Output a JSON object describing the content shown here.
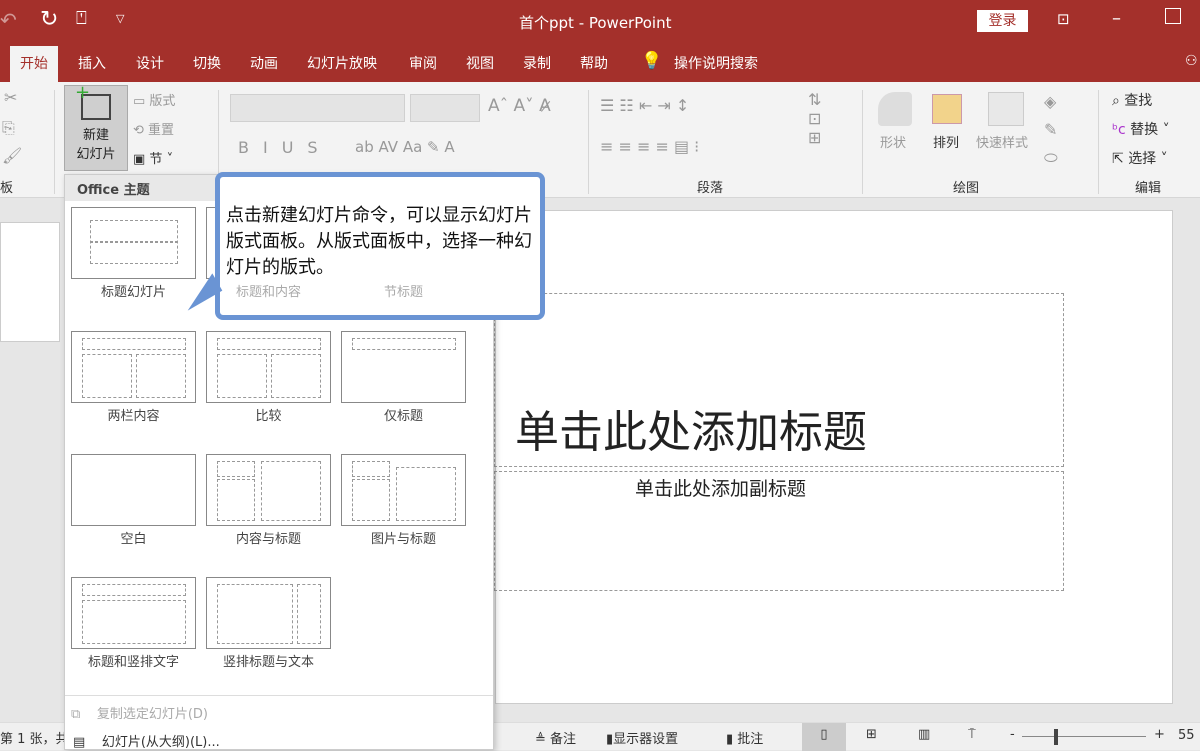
{
  "window": {
    "title": "首个ppt  -  PowerPoint",
    "login": "登录"
  },
  "tabs": [
    "开始",
    "插入",
    "设计",
    "切换",
    "动画",
    "幻灯片放映",
    "审阅",
    "视图",
    "录制",
    "帮助"
  ],
  "tell_me": "操作说明搜索",
  "ribbon": {
    "slides": {
      "new_slide_line1": "新建",
      "new_slide_line2": "幻灯片",
      "layout": "版式",
      "reset": "重置",
      "section": "节"
    },
    "clipboard_label": "板",
    "paragraph_label": "段落",
    "drawing": {
      "shape": "形状",
      "arrange": "排列",
      "quick_styles": "快速样式",
      "label": "绘图"
    },
    "editing": {
      "find": "查找",
      "replace": "替换",
      "select": "选择",
      "label": "编辑"
    }
  },
  "gallery": {
    "header": "Office 主题",
    "layouts": [
      "标题幻灯片",
      "标题和内容",
      "节标题",
      "两栏内容",
      "比较",
      "仅标题",
      "空白",
      "内容与标题",
      "图片与标题",
      "标题和竖排文字",
      "竖排标题与文本"
    ],
    "duplicate": "复制选定幻灯片(D)",
    "from_outline": "幻灯片(从大纲)(L)..."
  },
  "callout": "点击新建幻灯片命令，可以显示幻灯片版式面板。从版式面板中，选择一种幻灯片的版式。",
  "slide": {
    "title": "单击此处添加标题",
    "subtitle": "单击此处添加副标题"
  },
  "status": {
    "slide_info": "第 1 张，共",
    "notes": "备注",
    "display": "显示器设置",
    "comments": "批注",
    "zoom": "55"
  },
  "colors": {
    "accent": "#a4302b",
    "callout_border": "#6a94d4"
  }
}
